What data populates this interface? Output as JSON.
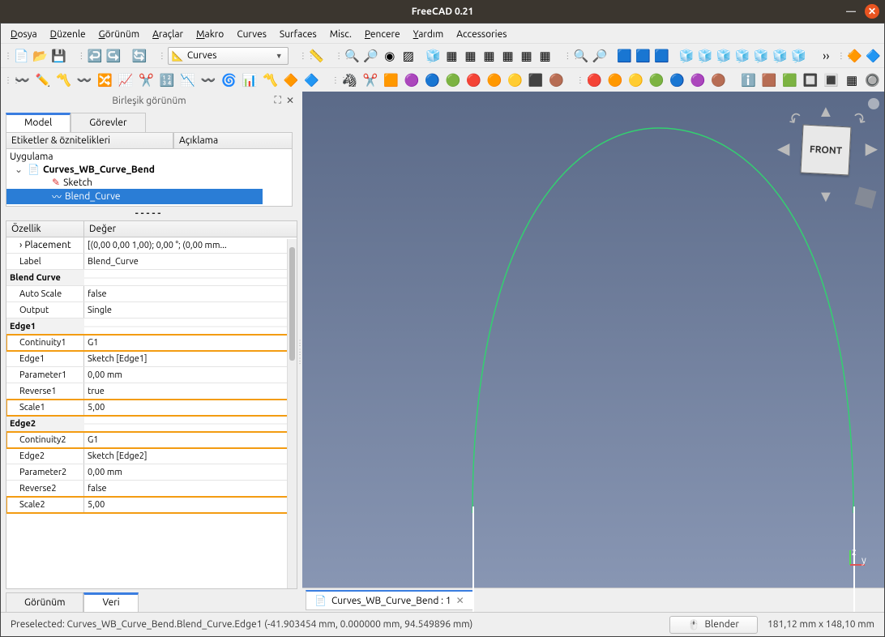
{
  "title": "FreeCAD 0.21",
  "menu": [
    "Dosya",
    "Düzenle",
    "Görünüm",
    "Araçlar",
    "Makro",
    "Curves",
    "Surfaces",
    "Misc.",
    "Pencere",
    "Yardım",
    "Accessories"
  ],
  "menu_u": [
    "D",
    "D",
    "G",
    "A",
    "M",
    "",
    "",
    "",
    "P",
    "Y",
    ""
  ],
  "workbench": "Curves",
  "panel": {
    "title": "Birleşik görünüm"
  },
  "tabs": {
    "model": "Model",
    "tasks": "Görevler"
  },
  "tree_headers": [
    "Etiketler & öznitelikleri",
    "Açıklama"
  ],
  "tree": {
    "app": "Uygulama",
    "doc": "Curves_WB_Curve_Bend",
    "sketch": "Sketch",
    "blend": "Blend_Curve"
  },
  "prop_headers": [
    "Özellik",
    "Değer"
  ],
  "props": {
    "placement_k": "Placement",
    "placement_v": "[(0,00 0,00 1,00); 0,00 °; (0,00 mm...",
    "label_k": "Label",
    "label_v": "Blend_Curve",
    "grp_blend": "Blend Curve",
    "autoscale_k": "Auto Scale",
    "autoscale_v": "false",
    "output_k": "Output",
    "output_v": "Single",
    "grp_e1": "Edge1",
    "cont1_k": "Continuity1",
    "cont1_v": "G1",
    "edge1_k": "Edge1",
    "edge1_v": "Sketch [Edge1]",
    "par1_k": "Parameter1",
    "par1_v": "0,00 mm",
    "rev1_k": "Reverse1",
    "rev1_v": "true",
    "sc1_k": "Scale1",
    "sc1_v": "5,00",
    "grp_e2": "Edge2",
    "cont2_k": "Continuity2",
    "cont2_v": "G1",
    "edge2_k": "Edge2",
    "edge2_v": "Sketch [Edge2]",
    "par2_k": "Parameter2",
    "par2_v": "0,00 mm",
    "rev2_k": "Reverse2",
    "rev2_v": "false",
    "sc2_k": "Scale2",
    "sc2_v": "5,00"
  },
  "bottom_tabs": {
    "view": "Görünüm",
    "data": "Veri"
  },
  "doc_tab": "Curves_WB_Curve_Bend : 1",
  "status": {
    "presel": "Preselected: Curves_WB_Curve_Bend.Blend_Curve.Edge1 (-41.903454 mm, 0.000000 mm, 94.549896 mm)",
    "nav": "Blender",
    "dims": "181,12 mm x 148,10 mm"
  },
  "navcube": "FRONT"
}
